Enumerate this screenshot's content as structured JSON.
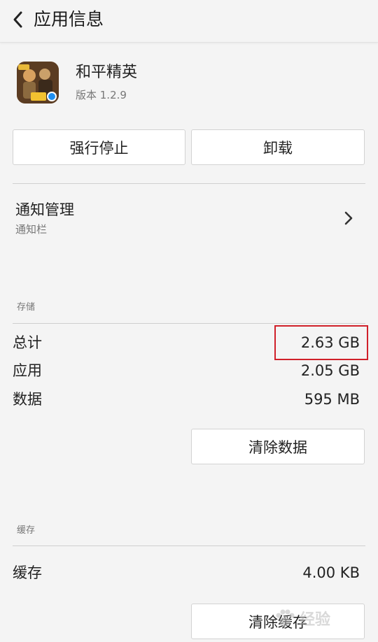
{
  "header": {
    "title": "应用信息",
    "back_icon": "chevron-left-icon"
  },
  "app": {
    "name": "和平精英",
    "version": "版本 1.2.9",
    "icon": "game-app-icon"
  },
  "actions": {
    "force_stop": "强行停止",
    "uninstall": "卸载"
  },
  "notifications": {
    "title": "通知管理",
    "subtitle": "通知栏",
    "chevron_icon": "chevron-right-icon"
  },
  "storage": {
    "section_label": "存储",
    "rows": [
      {
        "label": "总计",
        "value": "2.63 GB"
      },
      {
        "label": "应用",
        "value": "2.05 GB"
      },
      {
        "label": "数据",
        "value": "595 MB"
      }
    ],
    "clear_data": "清除数据"
  },
  "cache": {
    "section_label": "缓存",
    "rows": [
      {
        "label": "缓存",
        "value": "4.00 KB"
      }
    ],
    "clear_cache": "清除缓存"
  },
  "annotation": {
    "highlight_color": "#d0202a"
  },
  "watermark": {
    "icon": "paw-icon",
    "text": "经验"
  }
}
